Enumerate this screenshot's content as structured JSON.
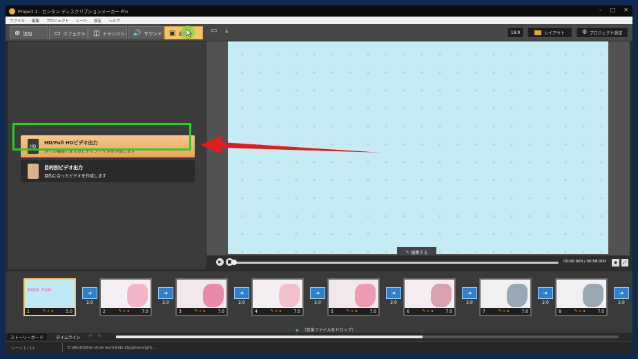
{
  "window": {
    "title": "Project 1 - カンタン ディスクリプションメーカー Pro",
    "controls": [
      "minimize",
      "maximize",
      "close"
    ]
  },
  "menu": {
    "items": [
      "ファイル",
      "編集",
      "プロジェクト",
      "シーン",
      "設定",
      "ヘルプ"
    ]
  },
  "toolbar": {
    "tabs": [
      {
        "label": "追加",
        "icon": "add-icon"
      },
      {
        "label": "エフェクト...",
        "icon": "effect-icon"
      },
      {
        "label": "トランジシ...",
        "icon": "transition-icon"
      },
      {
        "label": "サウンド",
        "icon": "sound-icon"
      },
      {
        "label": "出力",
        "icon": "output-icon",
        "active": true
      }
    ],
    "ratio_label": "16:9",
    "layout_label": "レイアウト",
    "settings_label": "プロジェクト設定"
  },
  "output_panel": {
    "options": [
      {
        "title": "HD/Full HDビデオ出力",
        "subtitle": "多くの機器で使えるビデオファイルを作成します",
        "highlighted": true
      },
      {
        "title": "目的別ビデオ出力",
        "subtitle": "目的に合ったビデオを作成します",
        "highlighted": false
      }
    ]
  },
  "preview": {
    "edit_label": "編集する",
    "timecode": "00:00.000 / 00:58.000"
  },
  "storyboard": {
    "slides": [
      {
        "number": "1",
        "duration": "5.0",
        "title": "KIDS' FUN",
        "selected": true,
        "color": "#bfe9f5"
      },
      {
        "number": "2",
        "duration": "7.0",
        "title": "",
        "selected": false,
        "color": "#f5eef4"
      },
      {
        "number": "3",
        "duration": "7.0",
        "title": "",
        "selected": false,
        "color": "#f3e7ee"
      },
      {
        "number": "4",
        "duration": "7.0",
        "title": "",
        "selected": false,
        "color": "#f4edf1"
      },
      {
        "number": "5",
        "duration": "7.0",
        "title": "",
        "selected": false,
        "color": "#f0e8ea"
      },
      {
        "number": "6",
        "duration": "7.0",
        "title": "",
        "selected": false,
        "color": "#f4ecf0"
      },
      {
        "number": "7",
        "duration": "7.0",
        "title": "",
        "selected": false,
        "color": "#f2f0f2"
      },
      {
        "number": "8",
        "duration": "7.0",
        "title": "",
        "selected": false,
        "color": "#f2f0f2"
      }
    ],
    "transitions": [
      "2.0",
      "2.0",
      "2.0",
      "2.0",
      "2.0",
      "2.0",
      "2.0",
      "2.0"
    ],
    "drop_hint": "（音楽ファイルをドロップ）"
  },
  "bottom_tabs": [
    "ストーリーボード",
    "タイムライン"
  ],
  "status": {
    "scene": "シーン 1 / 12",
    "path": "E:\\Work\\Slide show work\\kids Zip\\photos\\gif\\..."
  },
  "colors": {
    "accent": "#f3c469",
    "highlight_box": "#1ed41e",
    "annotation_arrow": "#e31b1b",
    "canvas_bg": "#c5ecf5"
  }
}
